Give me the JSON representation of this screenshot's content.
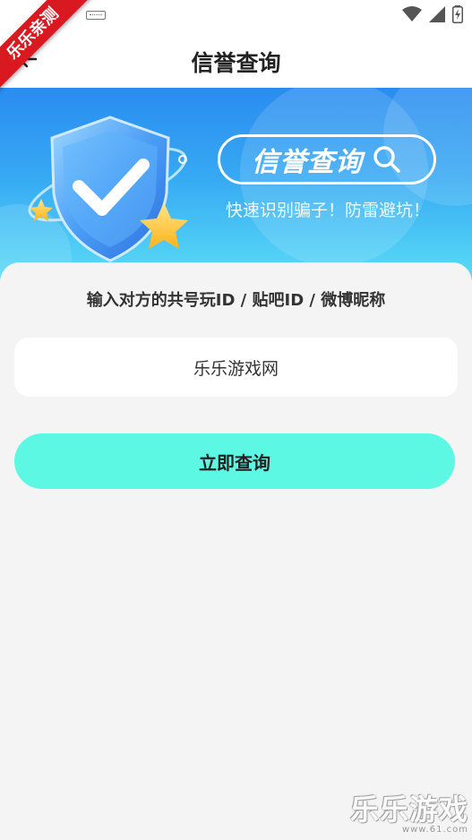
{
  "ribbon": {
    "text": "乐乐亲测"
  },
  "header": {
    "title": "信誉查询"
  },
  "banner": {
    "badge_text": "信誉查询",
    "slogan": "快速识别骗子！防雷避坑！"
  },
  "form": {
    "prompt": "输入对方的共号玩ID / 贴吧ID / 微博昵称",
    "input_value": "乐乐游戏网",
    "button_label": "立即查询"
  },
  "watermark": {
    "brand": "乐乐游戏",
    "url": "www.61.com"
  },
  "colors": {
    "button": "#5cf8e3",
    "banner_top": "#2a8cf0",
    "banner_bottom": "#59dcf6",
    "ribbon": "#d8191f"
  }
}
